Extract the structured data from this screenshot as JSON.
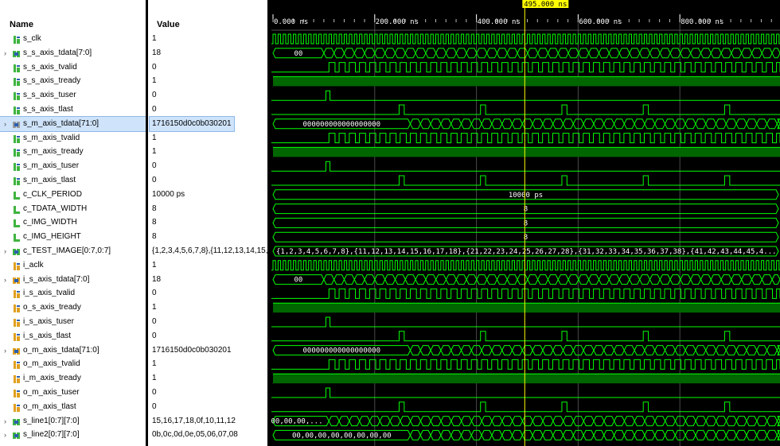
{
  "headers": {
    "name": "Name",
    "value": "Value"
  },
  "timeline": {
    "cursor_label": "495.000 ns",
    "cursor_ns": 495,
    "view_start_ns": 0,
    "ns_per_tick": 200,
    "tick_labels": [
      "0.000 ns",
      "200.000 ns",
      "400.000 ns",
      "600.000 ns",
      "800.000 ns"
    ]
  },
  "colors": {
    "wave": "#00ff00",
    "wave_fill": "#006600",
    "cursor": "#ffff00",
    "grid": "#4a4a4a"
  },
  "signals": [
    {
      "name": "s_clk",
      "value": "1",
      "kind": "bit",
      "icon": "signal-icon",
      "icon_color": "#3fb43f",
      "expand": false,
      "wave": "clock"
    },
    {
      "name": "s_s_axis_tdata[7:0]",
      "value": "18",
      "kind": "bus",
      "icon": "bus-icon",
      "icon_color": "#3fb43f",
      "expand": true,
      "wave": "bus",
      "first_value": "00"
    },
    {
      "name": "s_s_axis_tvalid",
      "value": "0",
      "kind": "bit",
      "icon": "signal-icon",
      "icon_color": "#3fb43f",
      "expand": false,
      "wave": "pulses"
    },
    {
      "name": "s_s_axis_tready",
      "value": "1",
      "kind": "bit",
      "icon": "signal-icon",
      "icon_color": "#3fb43f",
      "expand": false,
      "wave": "high"
    },
    {
      "name": "s_s_axis_tuser",
      "value": "0",
      "kind": "bit",
      "icon": "signal-icon",
      "icon_color": "#3fb43f",
      "expand": false,
      "wave": "tuser"
    },
    {
      "name": "s_s_axis_tlast",
      "value": "0",
      "kind": "bit",
      "icon": "signal-icon",
      "icon_color": "#3fb43f",
      "expand": false,
      "wave": "tlast"
    },
    {
      "name": "s_m_axis_tdata[71:0]",
      "value": "1716150d0c0b030201",
      "kind": "bus",
      "icon": "bus-icon",
      "icon_color": "#9a9a9a",
      "expand": true,
      "wave": "bus_wide",
      "first_value": "000000000000000000",
      "selected": true
    },
    {
      "name": "s_m_axis_tvalid",
      "value": "1",
      "kind": "bit",
      "icon": "signal-icon",
      "icon_color": "#3fb43f",
      "expand": false,
      "wave": "pulses"
    },
    {
      "name": "s_m_axis_tready",
      "value": "1",
      "kind": "bit",
      "icon": "signal-icon",
      "icon_color": "#3fb43f",
      "expand": false,
      "wave": "high"
    },
    {
      "name": "s_m_axis_tuser",
      "value": "0",
      "kind": "bit",
      "icon": "signal-icon",
      "icon_color": "#3fb43f",
      "expand": false,
      "wave": "tuser"
    },
    {
      "name": "s_m_axis_tlast",
      "value": "0",
      "kind": "bit",
      "icon": "signal-icon",
      "icon_color": "#3fb43f",
      "expand": false,
      "wave": "tlast"
    },
    {
      "name": "c_CLK_PERIOD",
      "value": "10000 ps",
      "kind": "const",
      "icon": "constant-icon",
      "icon_color": "#3fb43f",
      "expand": false,
      "wave": "const",
      "wave_label": "10000 ps"
    },
    {
      "name": "c_TDATA_WIDTH",
      "value": "8",
      "kind": "const",
      "icon": "constant-icon",
      "icon_color": "#3fb43f",
      "expand": false,
      "wave": "const",
      "wave_label": "8"
    },
    {
      "name": "c_IMG_WIDTH",
      "value": "8",
      "kind": "const",
      "icon": "constant-icon",
      "icon_color": "#3fb43f",
      "expand": false,
      "wave": "const",
      "wave_label": "8"
    },
    {
      "name": "c_IMG_HEIGHT",
      "value": "8",
      "kind": "const",
      "icon": "constant-icon",
      "icon_color": "#3fb43f",
      "expand": false,
      "wave": "const",
      "wave_label": "8"
    },
    {
      "name": "c_TEST_IMAGE[0:7,0:7]",
      "value": "{1,2,3,4,5,6,7,8},{11,12,13,14,15,16",
      "kind": "bus",
      "icon": "bus-icon",
      "icon_color": "#3fb43f",
      "expand": true,
      "wave": "const_left",
      "wave_label": "{1,2,3,4,5,6,7,8},{11,12,13,14,15,16,17,18},{21,22,23,24,25,26,27,28},{31,32,33,34,35,36,37,38},{41,42,43,44,45,4..."
    },
    {
      "name": "i_aclk",
      "value": "1",
      "kind": "bit",
      "icon": "signal-icon",
      "icon_color": "#e0a020",
      "expand": false,
      "wave": "clock"
    },
    {
      "name": "i_s_axis_tdata[7:0]",
      "value": "18",
      "kind": "bus",
      "icon": "bus-icon",
      "icon_color": "#e0a020",
      "expand": true,
      "wave": "bus",
      "first_value": "00"
    },
    {
      "name": "i_s_axis_tvalid",
      "value": "0",
      "kind": "bit",
      "icon": "signal-icon",
      "icon_color": "#e0a020",
      "expand": false,
      "wave": "pulses"
    },
    {
      "name": "o_s_axis_tready",
      "value": "1",
      "kind": "bit",
      "icon": "signal-icon",
      "icon_color": "#e0a020",
      "expand": false,
      "wave": "high"
    },
    {
      "name": "i_s_axis_tuser",
      "value": "0",
      "kind": "bit",
      "icon": "signal-icon",
      "icon_color": "#e0a020",
      "expand": false,
      "wave": "tuser"
    },
    {
      "name": "i_s_axis_tlast",
      "value": "0",
      "kind": "bit",
      "icon": "signal-icon",
      "icon_color": "#e0a020",
      "expand": false,
      "wave": "tlast"
    },
    {
      "name": "o_m_axis_tdata[71:0]",
      "value": "1716150d0c0b030201",
      "kind": "bus",
      "icon": "bus-icon",
      "icon_color": "#e0a020",
      "expand": true,
      "wave": "bus_wide",
      "first_value": "000000000000000000"
    },
    {
      "name": "o_m_axis_tvalid",
      "value": "1",
      "kind": "bit",
      "icon": "signal-icon",
      "icon_color": "#e0a020",
      "expand": false,
      "wave": "pulses"
    },
    {
      "name": "i_m_axis_tready",
      "value": "1",
      "kind": "bit",
      "icon": "signal-icon",
      "icon_color": "#e0a020",
      "expand": false,
      "wave": "high"
    },
    {
      "name": "o_m_axis_tuser",
      "value": "0",
      "kind": "bit",
      "icon": "signal-icon",
      "icon_color": "#e0a020",
      "expand": false,
      "wave": "tuser"
    },
    {
      "name": "o_m_axis_tlast",
      "value": "0",
      "kind": "bit",
      "icon": "signal-icon",
      "icon_color": "#e0a020",
      "expand": false,
      "wave": "tlast"
    },
    {
      "name": "s_line1[0:7][7:0]",
      "value": "15,16,17,18,0f,10,11,12",
      "kind": "bus",
      "icon": "bus-icon",
      "icon_color": "#3fb43f",
      "expand": true,
      "wave": "bus_line1",
      "first_value": "00,00,00,..."
    },
    {
      "name": "s_line2[0:7][7:0]",
      "value": "0b,0c,0d,0e,05,06,07,08",
      "kind": "bus",
      "icon": "bus-icon",
      "icon_color": "#3fb43f",
      "expand": true,
      "wave": "bus_line2",
      "first_value": "00,00,00,00,00,00,00,00"
    }
  ]
}
